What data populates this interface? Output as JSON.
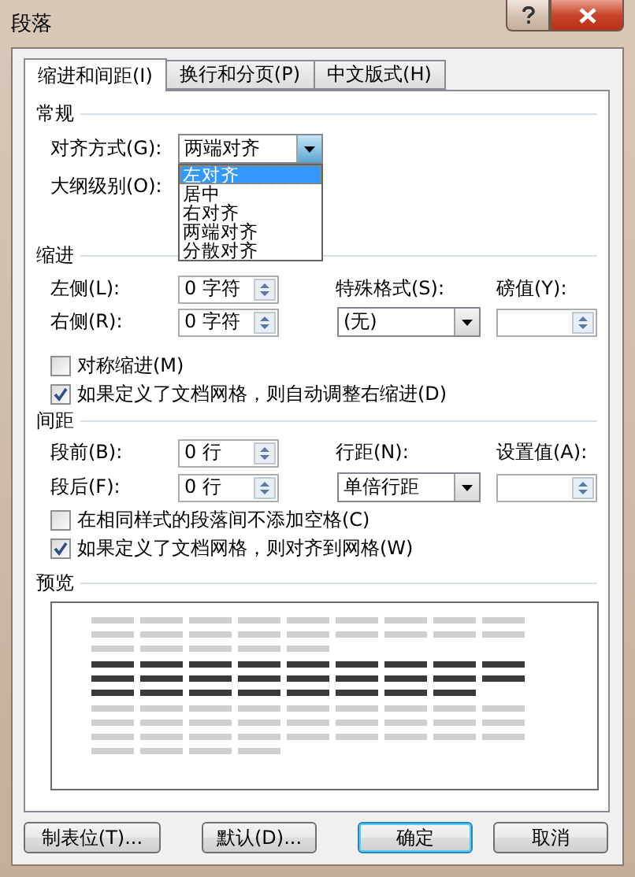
{
  "window": {
    "title": "段落"
  },
  "tabs": [
    {
      "label": "缩进和间距(I)",
      "selected": true
    },
    {
      "label": "换行和分页(P)",
      "selected": false
    },
    {
      "label": "中文版式(H)",
      "selected": false
    }
  ],
  "general": {
    "heading": "常规",
    "alignment": {
      "label": "对齐方式(G):",
      "value": "两端对齐",
      "expanded": true,
      "options": [
        {
          "label": "左对齐",
          "highlighted": true
        },
        {
          "label": "居中",
          "highlighted": false
        },
        {
          "label": "右对齐",
          "highlighted": false
        },
        {
          "label": "两端对齐",
          "highlighted": false
        },
        {
          "label": "分散对齐",
          "highlighted": false
        }
      ]
    },
    "outline": {
      "label": "大纲级别(O):"
    }
  },
  "indent": {
    "heading": "缩进",
    "left": {
      "label": "左侧(L):",
      "value": "0 字符"
    },
    "right": {
      "label": "右侧(R):",
      "value": "0 字符"
    },
    "special": {
      "label": "特殊格式(S):",
      "value": "(无)"
    },
    "by": {
      "label": "磅值(Y):"
    },
    "checkboxes": [
      {
        "label": "对称缩进(M)",
        "checked": false
      },
      {
        "label": "如果定义了文档网格，则自动调整右缩进(D)",
        "checked": true
      }
    ]
  },
  "spacing": {
    "heading": "间距",
    "before": {
      "label": "段前(B):",
      "value": "0 行"
    },
    "after": {
      "label": "段后(F):",
      "value": "0 行"
    },
    "line": {
      "label": "行距(N):",
      "value": "单倍行距"
    },
    "at": {
      "label": "设置值(A):"
    },
    "checkboxes": [
      {
        "label": "在相同样式的段落间不添加空格(C)",
        "checked": false
      },
      {
        "label": "如果定义了文档网格，则对齐到网格(W)",
        "checked": true
      }
    ]
  },
  "preview": {
    "heading": "预览"
  },
  "buttons": [
    {
      "label": "制表位(T)...",
      "default": false
    },
    {
      "label": "默认(D)...",
      "default": false
    },
    {
      "label": "确定",
      "default": true
    },
    {
      "label": "取消",
      "default": false
    }
  ]
}
